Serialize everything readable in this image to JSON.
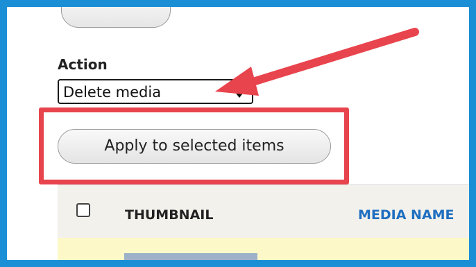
{
  "form": {
    "action_label": "Action",
    "action_selected": "Delete media",
    "apply_label": "Apply to selected items"
  },
  "table": {
    "columns": [
      "THUMBNAIL",
      "MEDIA NAME"
    ]
  },
  "colors": {
    "frame_border": "#1b8fd6",
    "highlight": "#e8444d",
    "link": "#1f6fc0",
    "selected_row": "#fdf8c8"
  }
}
